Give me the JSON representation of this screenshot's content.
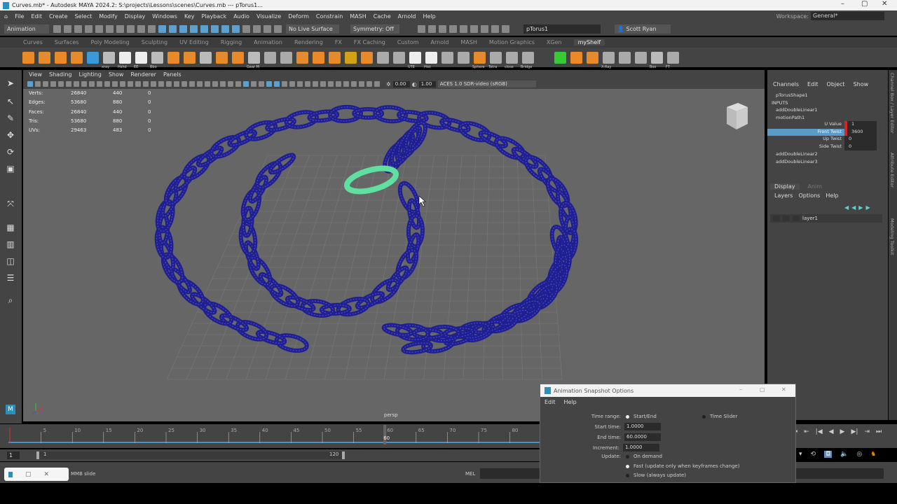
{
  "window": {
    "title": "Curves.mb* - Autodesk MAYA 2024.2: S:\\projects\\Lessons\\scenes\\Curves.mb  ---  pTorus1...",
    "minimize": "–",
    "maximize": "▢",
    "close": "✕"
  },
  "menubar": {
    "items": [
      "File",
      "Edit",
      "Create",
      "Select",
      "Modify",
      "Display",
      "Windows",
      "Key",
      "Playback",
      "Audio",
      "Visualize",
      "Deform",
      "Constrain",
      "MASH",
      "Cache",
      "Arnold",
      "Help"
    ],
    "workspace_label": "Workspace:",
    "workspace_value": "General*"
  },
  "statusline": {
    "mode": "Animation",
    "live_surface": "No Live Surface",
    "symmetry": "Symmetry: Off",
    "object_name": "pTorus1",
    "user": "Scott Ryan"
  },
  "shelf": {
    "tabs": [
      "Curves",
      "Surfaces",
      "Poly Modeling",
      "Sculpting",
      "UV Editing",
      "Rigging",
      "Animation",
      "Rendering",
      "FX",
      "FX Caching",
      "Custom",
      "Arnold",
      "MASH",
      "Motion Graphics",
      "XGen",
      "myShelf"
    ],
    "active_tab": "myShelf",
    "icons": [
      "",
      "",
      "",
      "",
      "",
      "xray",
      "Hshd",
      "EE",
      "Bbo",
      "",
      "",
      "",
      "",
      "",
      "Gear M",
      "",
      "",
      "",
      "",
      "",
      "",
      "",
      "",
      "",
      "UTE",
      "Hist",
      "",
      "",
      "Sphere",
      "Tetra",
      "close",
      "Bridge",
      "",
      "",
      "",
      "",
      "X-Ray",
      "",
      "",
      "Box",
      "FT"
    ]
  },
  "viewport": {
    "menu": [
      "View",
      "Shading",
      "Lighting",
      "Show",
      "Renderer",
      "Panels"
    ],
    "exposure": "0.00",
    "gamma": "1.00",
    "color_space": "ACES 1.0 SDR-video (sRGB)",
    "camera": "persp",
    "hud": [
      [
        "Verts:",
        "26840",
        "440",
        "0"
      ],
      [
        "Edges:",
        "53680",
        "880",
        "0"
      ],
      [
        "Faces:",
        "26840",
        "440",
        "0"
      ],
      [
        "Tris:",
        "53680",
        "880",
        "0"
      ],
      [
        "UVs:",
        "29463",
        "483",
        "0"
      ]
    ],
    "wire_color": "#1f1f8f",
    "selected_color": "#5fe0a0"
  },
  "channel_box": {
    "menu": [
      "Channels",
      "Edit",
      "Object",
      "Show"
    ],
    "shape": "pTorusShape1",
    "inputs_label": "INPUTS",
    "nodes_top": [
      "addDoubleLinear1",
      "motionPath1"
    ],
    "attributes": [
      {
        "name": "U Value",
        "value": "1"
      },
      {
        "name": "Front Twist",
        "value": "3600",
        "selected": true
      },
      {
        "name": "Up Twist",
        "value": "0"
      },
      {
        "name": "Side Twist",
        "value": "0"
      }
    ],
    "nodes_bottom": [
      "addDoubleLinear2",
      "addDoubleLinear3"
    ],
    "layer_tabs": [
      "Display",
      "Anim"
    ],
    "layer_menu": [
      "Layers",
      "Options",
      "Help"
    ],
    "layer": "layer1"
  },
  "side_tabs": [
    "Channel Box / Layer Editor",
    "Attribute Editor",
    "Modeling Toolkit"
  ],
  "timeline": {
    "ticks": [
      "5",
      "10",
      "15",
      "20",
      "25",
      "30",
      "35",
      "40",
      "45",
      "50",
      "55",
      "60",
      "65",
      "70",
      "75",
      "80"
    ],
    "current_frame": "60",
    "range_start": "1",
    "range_inner_start": "1",
    "range_inner_end": "120"
  },
  "command_line": {
    "help": "MMB slide",
    "language": "MEL"
  },
  "dialog": {
    "title": "Animation Snapshot Options",
    "menu": [
      "Edit",
      "Help"
    ],
    "time_range_label": "Time range:",
    "time_range_options": [
      "Start/End",
      "Time Slider"
    ],
    "start_time_label": "Start time:",
    "start_time": "1.0000",
    "end_time_label": "End time:",
    "end_time": "60.0000",
    "increment_label": "Increment:",
    "increment": "1.0000",
    "update_label": "Update:",
    "update_options": [
      "On demand",
      "Fast (update only when keyframes change)",
      "Slow (always update)"
    ]
  }
}
